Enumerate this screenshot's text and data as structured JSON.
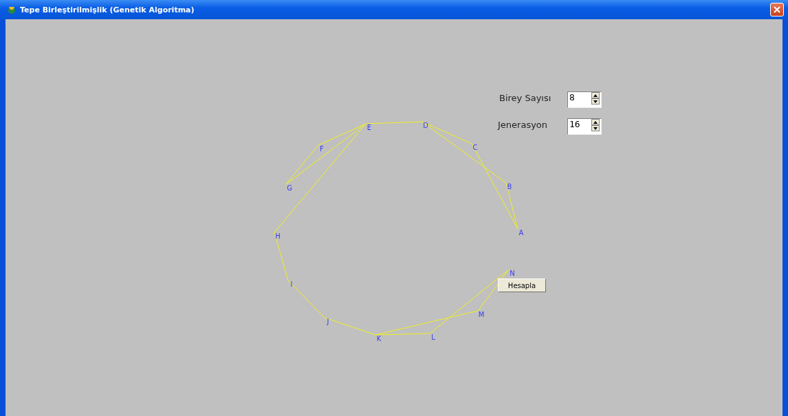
{
  "window": {
    "title": "Tepe Birleştirilmişlik (Genetik Algoritma)"
  },
  "fields": [
    {
      "label": "Birey Sayısı",
      "value": "8"
    },
    {
      "label": "Jenerasyon",
      "value": "16"
    }
  ],
  "button": {
    "label": "Hesapla"
  },
  "nodes": [
    "A",
    "B",
    "C",
    "D",
    "E",
    "F",
    "G",
    "H",
    "I",
    "J",
    "K",
    "L",
    "M",
    "N"
  ]
}
